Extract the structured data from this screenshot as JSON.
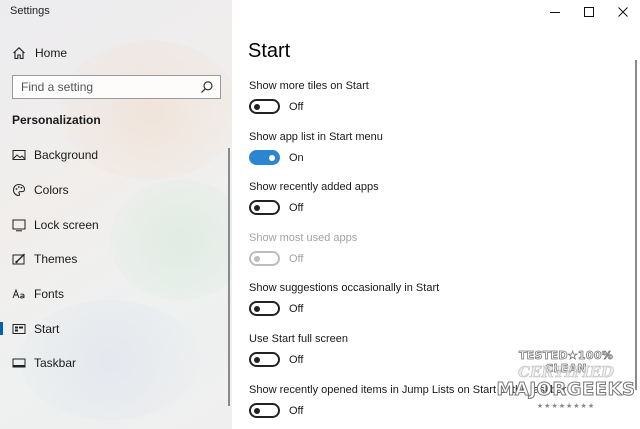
{
  "window": {
    "title": "Settings",
    "controls": {
      "minimize": "minimize",
      "maximize": "maximize",
      "close": "close"
    }
  },
  "sidebar": {
    "home_label": "Home",
    "search": {
      "placeholder": "Find a setting",
      "value": ""
    },
    "section_heading": "Personalization",
    "items": [
      {
        "label": "Background",
        "icon": "background-icon",
        "active": false
      },
      {
        "label": "Colors",
        "icon": "colors-icon",
        "active": false
      },
      {
        "label": "Lock screen",
        "icon": "lock-screen-icon",
        "active": false
      },
      {
        "label": "Themes",
        "icon": "themes-icon",
        "active": false
      },
      {
        "label": "Fonts",
        "icon": "fonts-icon",
        "active": false
      },
      {
        "label": "Start",
        "icon": "start-icon",
        "active": true
      },
      {
        "label": "Taskbar",
        "icon": "taskbar-icon",
        "active": false
      }
    ]
  },
  "main": {
    "title": "Start",
    "settings": [
      {
        "label": "Show more tiles on Start",
        "state": "Off",
        "on": false,
        "disabled": false
      },
      {
        "label": "Show app list in Start menu",
        "state": "On",
        "on": true,
        "disabled": false
      },
      {
        "label": "Show recently added apps",
        "state": "Off",
        "on": false,
        "disabled": false
      },
      {
        "label": "Show most used apps",
        "state": "Off",
        "on": false,
        "disabled": true
      },
      {
        "label": "Show suggestions occasionally in Start",
        "state": "Off",
        "on": false,
        "disabled": false
      },
      {
        "label": "Use Start full screen",
        "state": "Off",
        "on": false,
        "disabled": false
      },
      {
        "label": "Show recently opened items in Jump Lists on Start or the taskbar",
        "state": "Off",
        "on": false,
        "disabled": false
      }
    ]
  },
  "watermark": {
    "line1": "TESTED★100% CLEAN",
    "line2": "CERTIFIED",
    "line3": "MAJORGEEKS",
    "line4": "★★★★★★★★"
  },
  "colors": {
    "accent": "#0063b1",
    "toggle_on": "#2c86cf",
    "disabled_text": "#a3a3a3"
  }
}
